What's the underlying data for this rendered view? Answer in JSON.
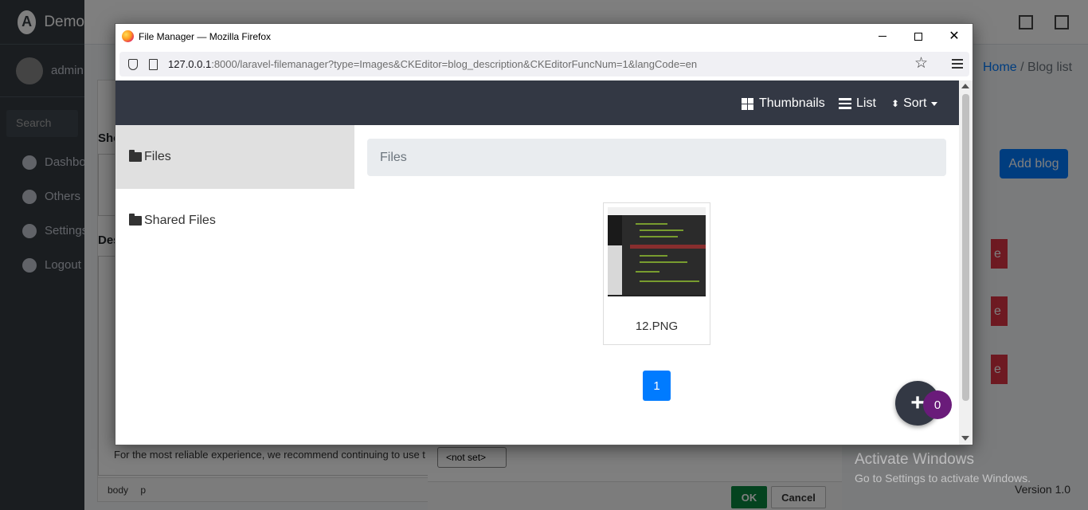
{
  "background": {
    "brand": "Demo",
    "user": "admin",
    "search_placeholder": "Search",
    "nav": [
      {
        "label": "Dashboard"
      },
      {
        "label": "Others"
      },
      {
        "label": "Settings"
      },
      {
        "label": "Logout"
      }
    ],
    "breadcrumb": {
      "home": "Home",
      "current": "Blog list"
    },
    "add_blog": "Add blog",
    "delete_label": "e",
    "short_label": "Sho",
    "desc_label": "Des",
    "reliable_text": "For the most reliable experience, we recommend continuing to use t",
    "editor_path": [
      "body",
      "p"
    ],
    "version": "Version 1.0",
    "ck_dialog": {
      "select_value": "<not set>",
      "ok": "OK",
      "cancel": "Cancel"
    }
  },
  "window": {
    "title": "File Manager — Mozilla Firefox",
    "url_host": "127.0.0.1",
    "url_rest": ":8000/laravel-filemanager?type=Images&CKEditor=blog_description&CKEditorFuncNum=1&langCode=en"
  },
  "file_manager": {
    "toolbar": {
      "thumbnails": "Thumbnails",
      "list": "List",
      "sort": "Sort"
    },
    "sidebar": [
      {
        "label": "Files",
        "active": true
      },
      {
        "label": "Shared Files",
        "active": false
      }
    ],
    "breadcrumb": "Files",
    "files": [
      {
        "name": "12.PNG"
      }
    ],
    "pagination": {
      "current": "1"
    },
    "fab": {
      "icon": "plus-icon",
      "count": "0"
    }
  },
  "windows_watermark": {
    "line1": "Activate Windows",
    "line2": "Go to Settings to activate Windows."
  },
  "colors": {
    "navbar": "#333844",
    "primary": "#007bff",
    "fab_badge": "#6a1b7a",
    "ok": "#09863e"
  }
}
